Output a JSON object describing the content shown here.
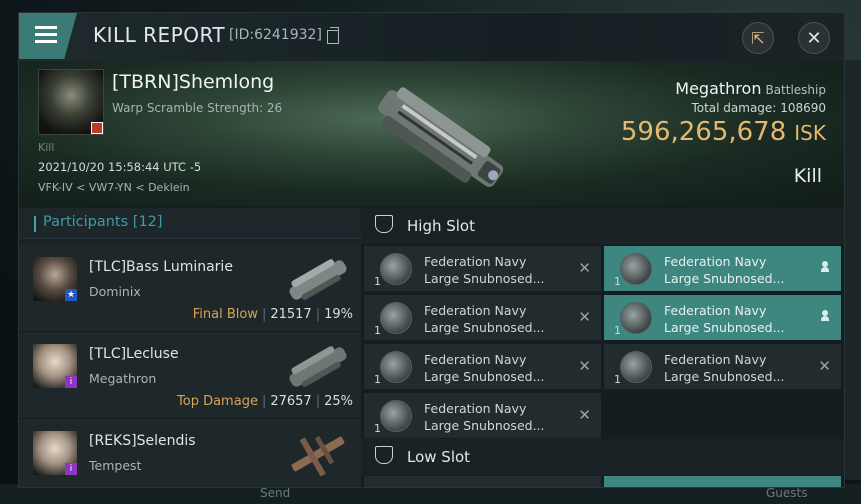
{
  "background": {
    "bottom_send": "Send",
    "bottom_guests": "Guests"
  },
  "window": {
    "title": "KILL REPORT",
    "id_label": "[ID:6241932]"
  },
  "victim": {
    "name": "[TBRN]Shemlong",
    "subtitle": "Warp Scramble Strength: 26",
    "tag": "Kill",
    "datetime": "2021/10/20 15:58:44 UTC -5",
    "location": "VFK-IV < VW7-YN < Deklein"
  },
  "ship": {
    "name": "Megathron",
    "class": "Battleship",
    "total_damage_label": "Total damage:",
    "total_damage": "108690",
    "isk_value": "596,265,678",
    "isk_unit": "ISK",
    "result": "Kill"
  },
  "participants": {
    "label": "Participants",
    "count": "[12]",
    "rows": [
      {
        "name": "[TLC]Bass Luminarie",
        "ship": "Dominix",
        "tag": "Final Blow",
        "damage": "21517",
        "percent": "19%",
        "badge": "★"
      },
      {
        "name": "[TLC]Lecluse",
        "ship": "Megathron",
        "tag": "Top Damage",
        "damage": "27657",
        "percent": "25%",
        "badge": "i"
      },
      {
        "name": "[REKS]Selendis",
        "ship": "Tempest",
        "tag": "",
        "damage": "",
        "percent": "",
        "badge": "i"
      }
    ]
  },
  "fitting": {
    "high_slot_label": "High Slot",
    "low_slot_label": "Low Slot",
    "high_modules_left": [
      {
        "qty": "1",
        "line1": "Federation Navy",
        "line2": "Large Snubnosed..."
      },
      {
        "qty": "1",
        "line1": "Federation Navy",
        "line2": "Large Snubnosed..."
      },
      {
        "qty": "1",
        "line1": "Federation Navy",
        "line2": "Large Snubnosed..."
      },
      {
        "qty": "1",
        "line1": "Federation Navy",
        "line2": "Large Snubnosed..."
      }
    ],
    "high_modules_right": [
      {
        "qty": "1",
        "line1": "Federation Navy",
        "line2": "Large Snubnosed..."
      },
      {
        "qty": "1",
        "line1": "Federation Navy",
        "line2": "Large Snubnosed..."
      },
      {
        "qty": "1",
        "line1": "Federation Navy",
        "line2": "Large Snubnosed..."
      }
    ]
  }
}
